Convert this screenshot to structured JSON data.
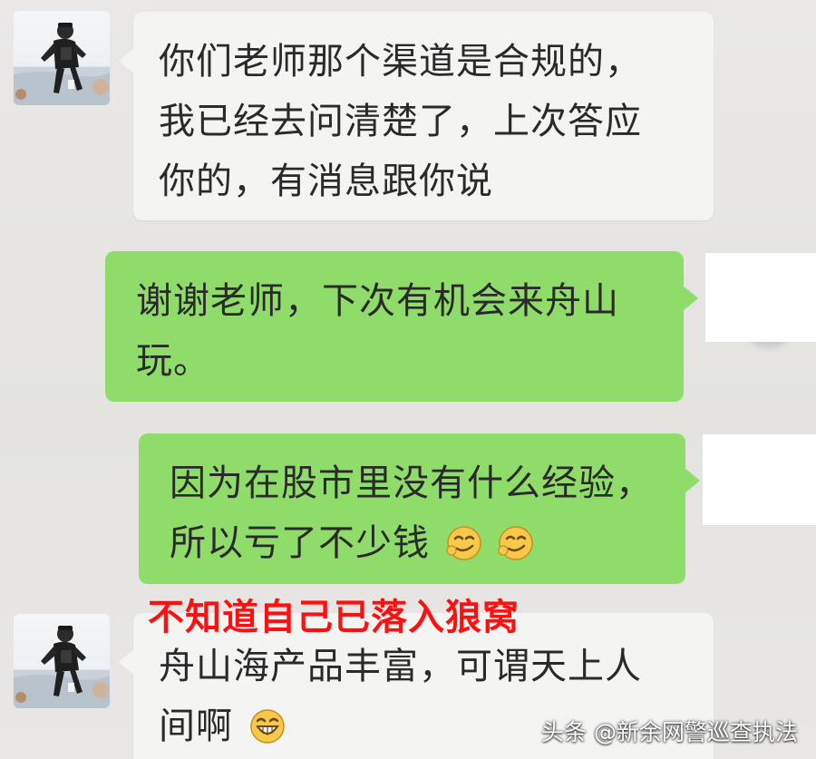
{
  "chat": {
    "messages": [
      {
        "sender": "contact",
        "lines": [
          "你们老师那个渠道是合规的，",
          "我已经去问清楚了，上次答应",
          "你的，有消息跟你说"
        ]
      },
      {
        "sender": "self",
        "lines": [
          "谢谢老师，下次有机会来舟山",
          "玩。"
        ]
      },
      {
        "sender": "self",
        "lines": [
          "因为在股市里没有什么经验，",
          "所以亏了不少钱"
        ],
        "emoji": [
          "smirk-emoji",
          "smirk-emoji"
        ]
      },
      {
        "sender": "contact",
        "lines": [
          "舟山海产品丰富，可谓天上人",
          "间啊"
        ],
        "emoji": [
          "grin-emoji"
        ]
      }
    ]
  },
  "annotation": {
    "text": "不知道自己已落入狼窝",
    "color": "#ff1010"
  },
  "watermark": {
    "text": "头条 @新余网警巡查执法"
  },
  "colors": {
    "background": "#e6e5e3",
    "contact_bubble": "#f4f4f3",
    "self_bubble": "#8fdc6a",
    "text": "#2a2a2a"
  },
  "icons": {
    "contact_avatar": "runner-photo-avatar",
    "self_avatar": "redacted-avatar"
  }
}
